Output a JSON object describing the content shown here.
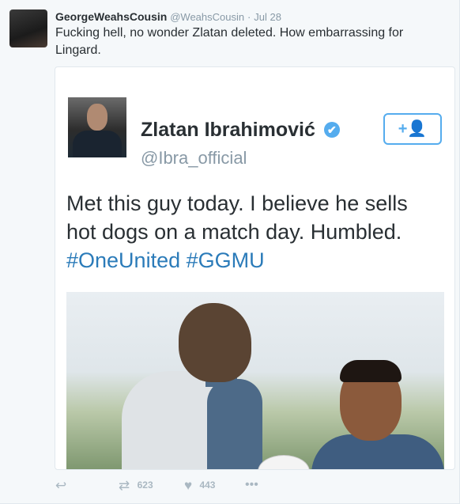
{
  "tweet": {
    "author": {
      "display_name": "GeorgeWeahsCousin",
      "handle": "@WeahsCousin",
      "separator": "·",
      "time": "Jul 28"
    },
    "text": "Fucking hell, no wonder Zlatan deleted. How embarrassing for Lingard."
  },
  "embedded": {
    "name": "Zlatan Ibrahimović",
    "verified_mark": "✔",
    "handle": "@Ibra_official",
    "follow_label": "+👤",
    "text_plain": "Met this guy today. I believe he sells hot dogs on a match day. Humbled.",
    "hashtag_1": "#OneUnited",
    "hashtag_2": "#GGMU"
  },
  "actions": {
    "reply_icon": "reply-icon",
    "retweet_count": "623",
    "like_count": "443",
    "more_label": "•••"
  },
  "colors": {
    "link": "#2b7bb9",
    "verified": "#55acee",
    "muted": "#8899a6",
    "text": "#292f33"
  }
}
